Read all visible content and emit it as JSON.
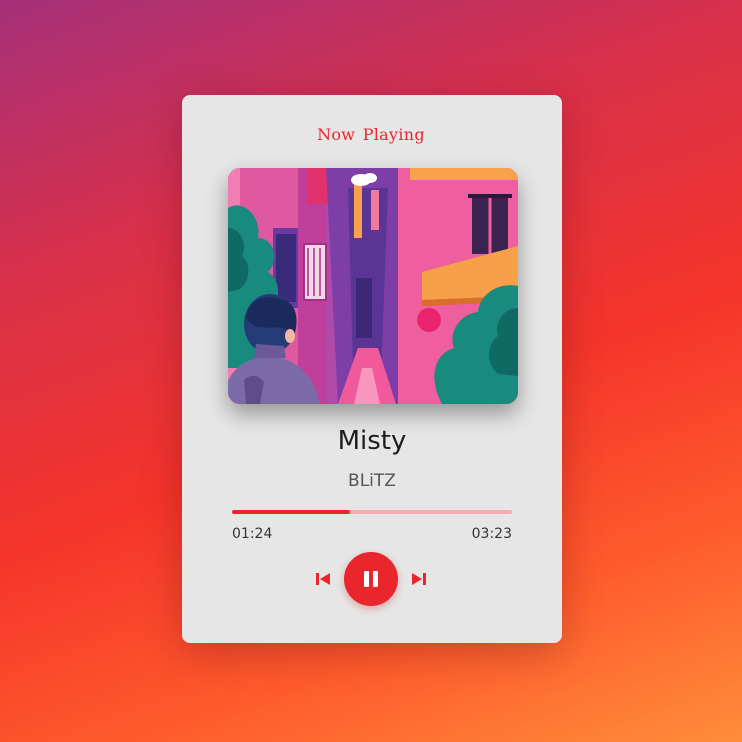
{
  "player": {
    "heading": "Now Playing",
    "track": {
      "title": "Misty",
      "artist": "BLiTZ"
    },
    "progress": {
      "current_time": "01:24",
      "duration": "03:23",
      "fraction": 0.42
    },
    "controls": {
      "previous_icon": "skip-previous-icon",
      "play_pause_icon": "pause-icon",
      "next_icon": "skip-next-icon"
    },
    "artwork": {
      "description_icon": "album-artwork-icon"
    },
    "colors": {
      "accent": "#e8262c",
      "card": "#e6e6e6",
      "progress_track": "#f2aeb0"
    }
  }
}
